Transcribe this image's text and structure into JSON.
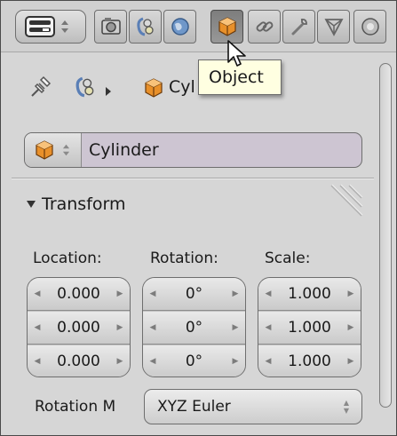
{
  "tabs": [
    {
      "icon": "render-icon",
      "active": false
    },
    {
      "icon": "scene-icon",
      "active": false
    },
    {
      "icon": "world-icon",
      "active": false
    },
    {
      "icon": "object-icon",
      "active": true
    },
    {
      "icon": "constraints-icon",
      "active": false
    },
    {
      "icon": "modifiers-icon",
      "active": false
    },
    {
      "icon": "object-data-icon",
      "active": false
    },
    {
      "icon": "material-icon",
      "active": false
    }
  ],
  "breadcrumb": {
    "pin_icon": "pin-icon",
    "scene_icon": "scene-icon",
    "object_icon": "object-icon",
    "text": "Cyl"
  },
  "tooltip": {
    "text": "Object"
  },
  "object_field": {
    "name": "Cylinder"
  },
  "transform": {
    "title": "Transform",
    "location_label": "Location:",
    "rotation_label": "Rotation:",
    "scale_label": "Scale:",
    "location": [
      "0.000",
      "0.000",
      "0.000"
    ],
    "rotation": [
      "0°",
      "0°",
      "0°"
    ],
    "scale": [
      "1.000",
      "1.000",
      "1.000"
    ]
  },
  "rotation_mode": {
    "label": "Rotation M",
    "value": "XYZ Euler"
  },
  "colors": {
    "panel_bg": "#d6d6d6",
    "active_tab": "#8a8a8a",
    "name_field": "#cdc5d2",
    "tooltip_bg": "#ffffe1",
    "object_orange": "#e8902a"
  }
}
